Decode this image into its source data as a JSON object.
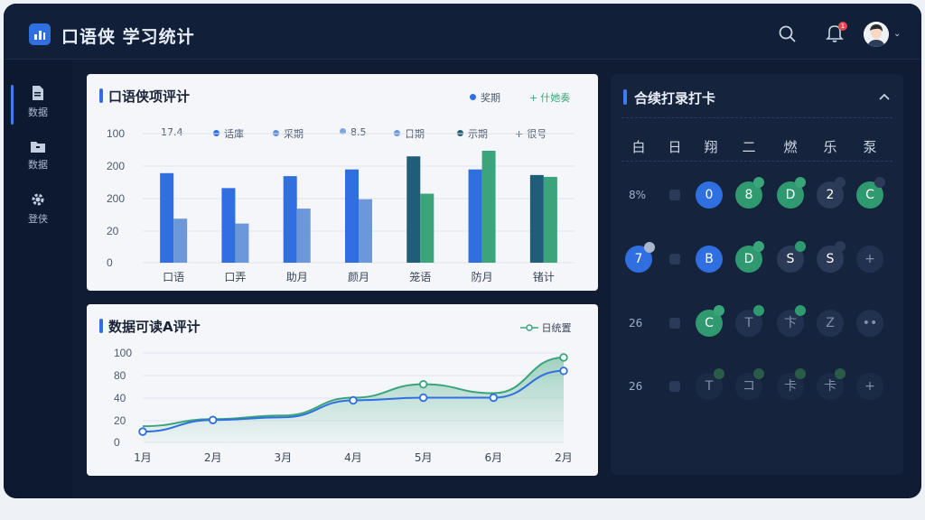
{
  "app": {
    "title": "口语侠 学习统计",
    "notification_count": "1"
  },
  "sidebar": {
    "items": [
      {
        "label": "数据",
        "icon": "document-icon",
        "active": true
      },
      {
        "label": "数据",
        "icon": "folder-icon",
        "active": false
      },
      {
        "label": "登侠",
        "icon": "gear-icon",
        "active": false
      }
    ]
  },
  "bar_card": {
    "title": "口语侠项评计",
    "legend_top": [
      {
        "label": "奖期",
        "color": "#2f6fe0",
        "kind": "dot"
      },
      {
        "label": "什她奏",
        "color": "#3aa57a",
        "kind": "plus"
      }
    ],
    "legend_row": [
      {
        "label": "17.4",
        "kind": "text",
        "color": "#4d5a70"
      },
      {
        "label": "话庫",
        "kind": "dot",
        "color": "#2f6fe0"
      },
      {
        "label": "采期",
        "kind": "dot",
        "color": "#5b8fd9"
      },
      {
        "label": "8.5",
        "kind": "dot",
        "color": "#7ea5e3"
      },
      {
        "label": "日期",
        "kind": "dot",
        "color": "#6c97d8"
      },
      {
        "label": "示期",
        "kind": "dot",
        "color": "#1f5d78"
      },
      {
        "label": "很号",
        "kind": "plus",
        "color": "#3b4658"
      }
    ]
  },
  "line_card": {
    "title": "数据可读A评计",
    "legend": "日统置"
  },
  "calendar": {
    "title": "合续打录打卡",
    "collapse_icon": "chevron-up-icon",
    "weekdays": [
      "白",
      "日",
      "翔",
      "二",
      "燃",
      "乐",
      "泵"
    ],
    "rows": [
      {
        "label": "8%",
        "cells": [
          {
            "kind": "sq"
          },
          {
            "kind": "circle",
            "text": "0",
            "color": "#2f6fe0",
            "pip": ""
          },
          {
            "kind": "circle",
            "text": "8",
            "color": "#2f9a6f",
            "pip": "#3aa57a"
          },
          {
            "kind": "circle",
            "text": "D",
            "color": "#2f9a6f",
            "pip": "#3aa57a"
          },
          {
            "kind": "circle",
            "text": "2",
            "color": "#2a3a57",
            "pip": "#2a3a57"
          },
          {
            "kind": "circle",
            "text": "C",
            "color": "#2f9a6f",
            "pip": "#2a3a57"
          }
        ],
        "first": {
          "kind": "none"
        }
      },
      {
        "label": "",
        "first": {
          "kind": "circle",
          "text": "7",
          "color": "#2f6fe0",
          "pip": "#a9b6cb"
        },
        "cells": [
          {
            "kind": "sq"
          },
          {
            "kind": "circle",
            "text": "B",
            "color": "#2f6fe0",
            "pip": ""
          },
          {
            "kind": "circle",
            "text": "D",
            "color": "#2f9a6f",
            "pip": "#3aa57a"
          },
          {
            "kind": "circle",
            "text": "S",
            "color": "#2a3a57",
            "pip": "#2f9a6f"
          },
          {
            "kind": "circle",
            "text": "S",
            "color": "#2a3a57",
            "pip": "#2a3a57"
          },
          {
            "kind": "circle",
            "text": "+",
            "color": "#22324e",
            "pip": ""
          }
        ]
      },
      {
        "label": "26",
        "first": {
          "kind": "none"
        },
        "cells": [
          {
            "kind": "sq"
          },
          {
            "kind": "circle",
            "text": "C",
            "color": "#2f9a6f",
            "pip": "#3aa57a"
          },
          {
            "kind": "circle",
            "text": "T",
            "color": "#22324e",
            "pip": "#2f9a6f"
          },
          {
            "kind": "circle",
            "text": "卞",
            "color": "#22324e",
            "pip": "#2f9a6f"
          },
          {
            "kind": "circle",
            "text": "Z",
            "color": "#22324e",
            "pip": ""
          },
          {
            "kind": "circle",
            "text": "••",
            "color": "#22324e",
            "pip": ""
          }
        ]
      },
      {
        "label": "26",
        "first": {
          "kind": "none"
        },
        "cells": [
          {
            "kind": "sq"
          },
          {
            "kind": "circle",
            "text": "T",
            "color": "#1c2b45",
            "pip": "#2a5a48"
          },
          {
            "kind": "circle",
            "text": "コ",
            "color": "#1c2b45",
            "pip": "#2a5a48"
          },
          {
            "kind": "circle",
            "text": "卡",
            "color": "#1c2b45",
            "pip": "#2a5a48"
          },
          {
            "kind": "circle",
            "text": "卡",
            "color": "#1c2b45",
            "pip": "#2a5a48"
          },
          {
            "kind": "circle",
            "text": "+",
            "color": "#1c2b45",
            "pip": ""
          }
        ]
      }
    ]
  },
  "chart_data": [
    {
      "type": "bar",
      "title": "口语侠项评计",
      "categories": [
        "口语",
        "口弄",
        "助月",
        "颜月",
        "笼语",
        "防月",
        "锗计"
      ],
      "y_tick_labels": [
        "100",
        "200",
        "200",
        "20",
        "0"
      ],
      "ylim": [
        0,
        300
      ],
      "series": [
        {
          "name": "奖期",
          "colors": [
            "#2f6fe0",
            "#2f6fe0",
            "#2f6fe0",
            "#2f6fe0",
            "#1f5d78",
            "#2f6fe0",
            "#1f5d78"
          ],
          "values": [
            240,
            200,
            232,
            250,
            285,
            250,
            235
          ]
        },
        {
          "name": "什她奏",
          "colors": [
            "#6c97d8",
            "#6c97d8",
            "#6c97d8",
            "#6c97d8",
            "#3aa57a",
            "#3aa57a",
            "#3aa57a"
          ],
          "values": [
            118,
            105,
            145,
            170,
            185,
            300,
            230
          ]
        }
      ],
      "grid": true
    },
    {
      "type": "line",
      "title": "数据可读A评计",
      "categories": [
        "1月",
        "2月",
        "3月",
        "4月",
        "5月",
        "6月",
        "2月"
      ],
      "y_tick_labels": [
        "100",
        "80",
        "40",
        "20",
        "0"
      ],
      "ylim": [
        0,
        100
      ],
      "series": [
        {
          "name": "日统置",
          "color": "#2f6fe0",
          "values": [
            12,
            25,
            28,
            47,
            50,
            50,
            80
          ]
        },
        {
          "name": "",
          "color": "#3aa57a",
          "values": [
            18,
            26,
            30,
            50,
            65,
            55,
            95
          ]
        }
      ],
      "grid": true
    }
  ]
}
